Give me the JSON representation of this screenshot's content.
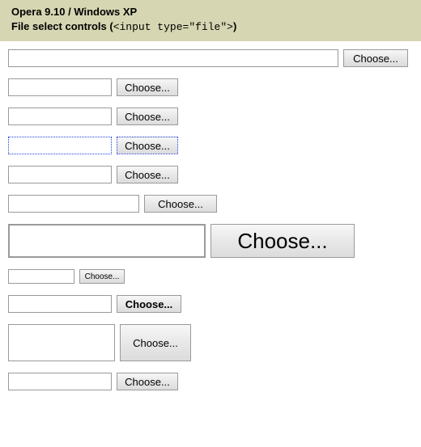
{
  "header": {
    "title": "Opera 9.10 / Windows XP",
    "subtitle_prefix": "File select controls (",
    "subtitle_code": "<input type=\"file\">",
    "subtitle_suffix": ")"
  },
  "button_label": "Choose...",
  "rows": [
    {
      "id": "r1",
      "value": ""
    },
    {
      "id": "r2",
      "value": ""
    },
    {
      "id": "r3",
      "value": ""
    },
    {
      "id": "r4",
      "value": ""
    },
    {
      "id": "r5",
      "value": ""
    },
    {
      "id": "r6",
      "value": ""
    },
    {
      "id": "r7",
      "value": ""
    },
    {
      "id": "r8",
      "value": ""
    },
    {
      "id": "r9",
      "value": ""
    },
    {
      "id": "r10",
      "value": ""
    },
    {
      "id": "r11",
      "value": ""
    }
  ]
}
